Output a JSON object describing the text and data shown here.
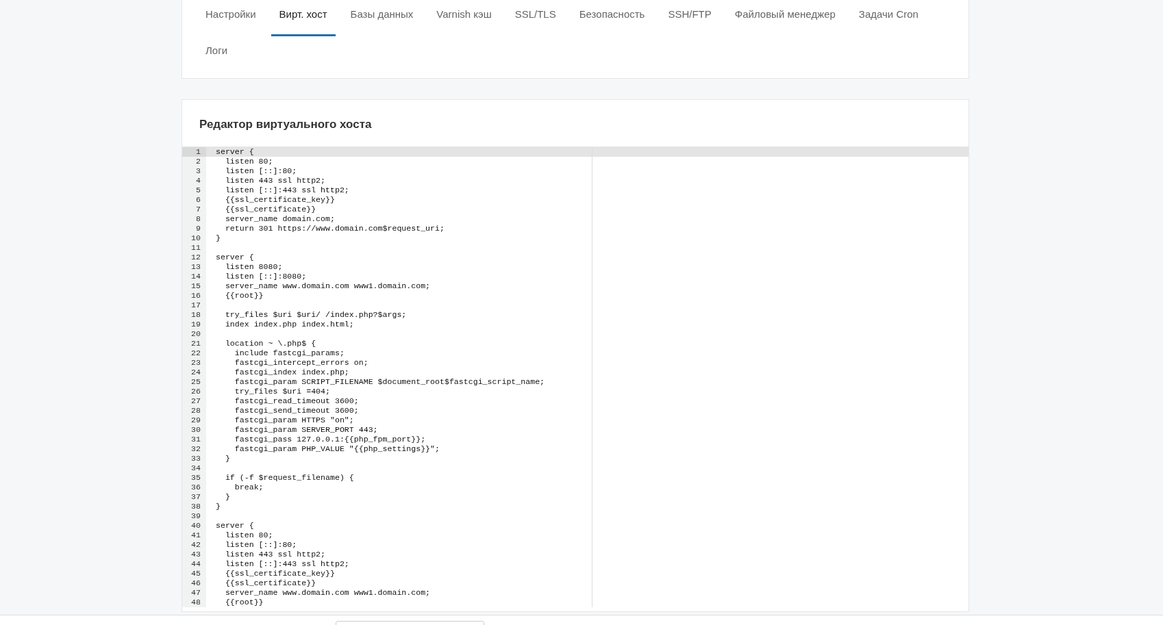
{
  "tabs": [
    {
      "label": "Настройки",
      "selected": false
    },
    {
      "label": "Вирт. хост",
      "selected": true
    },
    {
      "label": "Базы данных",
      "selected": false
    },
    {
      "label": "Varnish кэш",
      "selected": false
    },
    {
      "label": "SSL/TLS",
      "selected": false
    },
    {
      "label": "Безопасность",
      "selected": false
    },
    {
      "label": "SSH/FTP",
      "selected": false
    },
    {
      "label": "Файловый менеджер",
      "selected": false
    },
    {
      "label": "Задачи Cron",
      "selected": false
    },
    {
      "label": "Логи",
      "selected": false
    }
  ],
  "editor": {
    "title": "Редактор виртуального хоста",
    "lines": [
      {
        "number": "1",
        "text": "server {",
        "active": true
      },
      {
        "number": "2",
        "text": "  listen 80;",
        "active": false
      },
      {
        "number": "3",
        "text": "  listen [::]:80;",
        "active": false
      },
      {
        "number": "4",
        "text": "  listen 443 ssl http2;",
        "active": false
      },
      {
        "number": "5",
        "text": "  listen [::]:443 ssl http2;",
        "active": false
      },
      {
        "number": "6",
        "text": "  {{ssl_certificate_key}}",
        "active": false
      },
      {
        "number": "7",
        "text": "  {{ssl_certificate}}",
        "active": false
      },
      {
        "number": "8",
        "text": "  server_name domain.com;",
        "active": false
      },
      {
        "number": "9",
        "text": "  return 301 https://www.domain.com$request_uri;",
        "active": false
      },
      {
        "number": "10",
        "text": "}",
        "active": false
      },
      {
        "number": "11",
        "active": false
      },
      {
        "number": "12",
        "text": "server {",
        "active": false
      },
      {
        "number": "13",
        "text": "  listen 8080;",
        "active": false
      },
      {
        "number": "14",
        "text": "  listen [::]:8080;",
        "active": false
      },
      {
        "number": "15",
        "text": "  server_name www.domain.com www1.domain.com;",
        "active": false
      },
      {
        "number": "16",
        "text": "  {{root}}",
        "active": false
      },
      {
        "number": "17",
        "active": false
      },
      {
        "number": "18",
        "text": "  try_files $uri $uri/ /index.php?$args;",
        "active": false
      },
      {
        "number": "19",
        "text": "  index index.php index.html;",
        "active": false
      },
      {
        "number": "20",
        "active": false
      },
      {
        "number": "21",
        "text": "  location ~ \\.php$ {",
        "active": false
      },
      {
        "number": "22",
        "text": "    include fastcgi_params;",
        "active": false
      },
      {
        "number": "23",
        "text": "    fastcgi_intercept_errors on;",
        "active": false
      },
      {
        "number": "24",
        "text": "    fastcgi_index index.php;",
        "active": false
      },
      {
        "number": "25",
        "text": "    fastcgi_param SCRIPT_FILENAME $document_root$fastcgi_script_name;",
        "active": false
      },
      {
        "number": "26",
        "text": "    try_files $uri =404;",
        "active": false
      },
      {
        "number": "27",
        "text": "    fastcgi_read_timeout 3600;",
        "active": false
      },
      {
        "number": "28",
        "text": "    fastcgi_send_timeout 3600;",
        "active": false
      },
      {
        "number": "29",
        "text": "    fastcgi_param HTTPS \"on\";",
        "active": false
      },
      {
        "number": "30",
        "text": "    fastcgi_param SERVER_PORT 443;",
        "active": false
      },
      {
        "number": "31",
        "text": "    fastcgi_pass 127.0.0.1:{{php_fpm_port}};",
        "active": false
      },
      {
        "number": "32",
        "text": "    fastcgi_param PHP_VALUE \"{{php_settings}}\";",
        "active": false
      },
      {
        "number": "33",
        "text": "  }",
        "active": false
      },
      {
        "number": "34",
        "active": false
      },
      {
        "number": "35",
        "text": "  if (-f $request_filename) {",
        "active": false
      },
      {
        "number": "36",
        "text": "    break;",
        "active": false
      },
      {
        "number": "37",
        "text": "  }",
        "active": false
      },
      {
        "number": "38",
        "text": "}",
        "active": false
      },
      {
        "number": "39",
        "active": false
      },
      {
        "number": "40",
        "text": "server {",
        "active": false
      },
      {
        "number": "41",
        "text": "  listen 80;",
        "active": false
      },
      {
        "number": "42",
        "text": "  listen [::]:80;",
        "active": false
      },
      {
        "number": "43",
        "text": "  listen 443 ssl http2;",
        "active": false
      },
      {
        "number": "44",
        "text": "  listen [::]:443 ssl http2;",
        "active": false
      },
      {
        "number": "45",
        "text": "  {{ssl_certificate_key}}",
        "active": false
      },
      {
        "number": "46",
        "text": "  {{ssl_certificate}}",
        "active": false
      },
      {
        "number": "47",
        "text": "  server_name www.domain.com www1.domain.com;",
        "active": false
      },
      {
        "number": "48",
        "text": "  {{root}}",
        "active": false
      }
    ]
  }
}
